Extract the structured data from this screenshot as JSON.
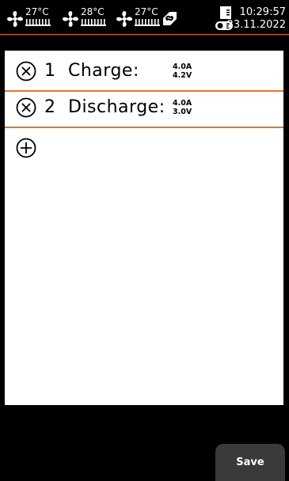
{
  "status_bar": {
    "fans": [
      {
        "temperature": "27°C"
      },
      {
        "temperature": "28°C"
      },
      {
        "temperature": "27°C"
      }
    ],
    "time": "10:29:57",
    "date": "23.11.2022",
    "accent_color": "#ff6a1f"
  },
  "steps": [
    {
      "number": "1",
      "name": "Charge:",
      "current": "4.0A",
      "voltage": "4.2V"
    },
    {
      "number": "2",
      "name": "Discharge:",
      "current": "4.0A",
      "voltage": "3.0V"
    }
  ],
  "actions": {
    "save_label": "Save"
  },
  "icons": [
    "fan-icon",
    "heatsink-icon",
    "link-icon",
    "sd-card-icon",
    "toggle-icon",
    "remove-circle-icon",
    "add-circle-icon"
  ]
}
